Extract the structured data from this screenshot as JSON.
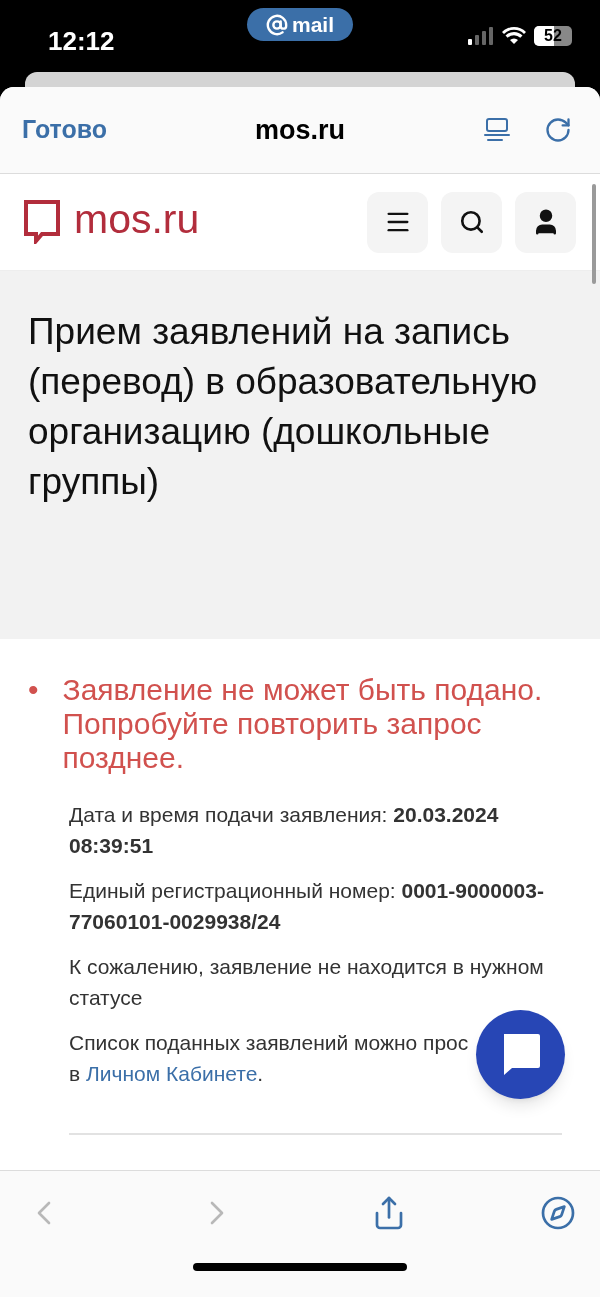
{
  "status_bar": {
    "time": "12:12",
    "back_app": "mail",
    "battery": "52"
  },
  "browser_header": {
    "done": "Готово",
    "title": "mos.ru"
  },
  "site_header": {
    "logo": "mos.ru"
  },
  "page_title": "Прием заявлений на запись (перевод) в образовательную организацию (дошкольные группы)",
  "error": {
    "bullet": "•",
    "message": "Заявление не может быть подано. Попробуйте повторить запрос позднее."
  },
  "details": [
    {
      "text": "Дата и время подачи заявления: **20.03.2024 08:39:51**"
    },
    {
      "text": "Единый регистрационный номер: **0001-9000003-77060101-0029938/24**"
    },
    {
      "text": "К сожалению, заявление не находится в нужном статусе"
    }
  ],
  "list_note": {
    "line": "Список поданных заявлений можно прос",
    "prefix": "в",
    "link": "Личном Кабинете",
    "suffix": "."
  },
  "toolbar": [
    {
      "kind": "back",
      "disabled": true
    },
    {
      "kind": "forward",
      "disabled": true
    },
    {
      "kind": "share",
      "disabled": false
    },
    {
      "kind": "compass",
      "disabled": false
    }
  ]
}
